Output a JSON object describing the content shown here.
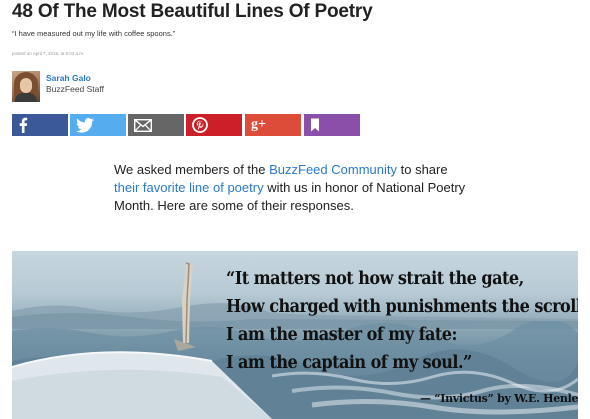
{
  "article": {
    "title": "48 Of The Most Beautiful Lines Of Poetry",
    "subtitle": "“I have measured out my life with coffee spoons.”",
    "posted": "posted on April 7, 2015, at 9:03 a.m."
  },
  "author": {
    "name": "Sarah Galo",
    "role": "BuzzFeed Staff"
  },
  "share": {
    "buttons": [
      {
        "network": "facebook",
        "icon": "facebook-icon",
        "color": "#3b5998"
      },
      {
        "network": "twitter",
        "icon": "twitter-icon",
        "color": "#55acee"
      },
      {
        "network": "email",
        "icon": "email-icon",
        "color": "#666666"
      },
      {
        "network": "pinterest",
        "icon": "pinterest-icon",
        "color": "#cb2027"
      },
      {
        "network": "google-plus",
        "icon": "google-plus-icon",
        "label": "g+",
        "color": "#dd4b39"
      },
      {
        "network": "bookmark",
        "icon": "bookmark-icon",
        "color": "#8a4fa8"
      }
    ]
  },
  "intro": {
    "part1": "We asked members of the ",
    "link1": "BuzzFeed Community",
    "part2": " to share ",
    "link2": "their favorite line of poetry",
    "part3": " with us in honor of National Poetry Month. Here are some of their responses."
  },
  "poem": {
    "lines": [
      "“It matters not how strait the gate,",
      "How charged with punishments the scroll,",
      "I am the master of my fate:",
      "I am the captain of my soul.”"
    ],
    "attribution": "— “Invictus” by W.E. Henley"
  },
  "colors": {
    "link": "#2a7ac9",
    "facebook": "#3b5998",
    "twitter": "#55acee",
    "email": "#666666",
    "pinterest": "#cb2027",
    "google_plus": "#dd4b39",
    "bookmark": "#8a4fa8"
  }
}
